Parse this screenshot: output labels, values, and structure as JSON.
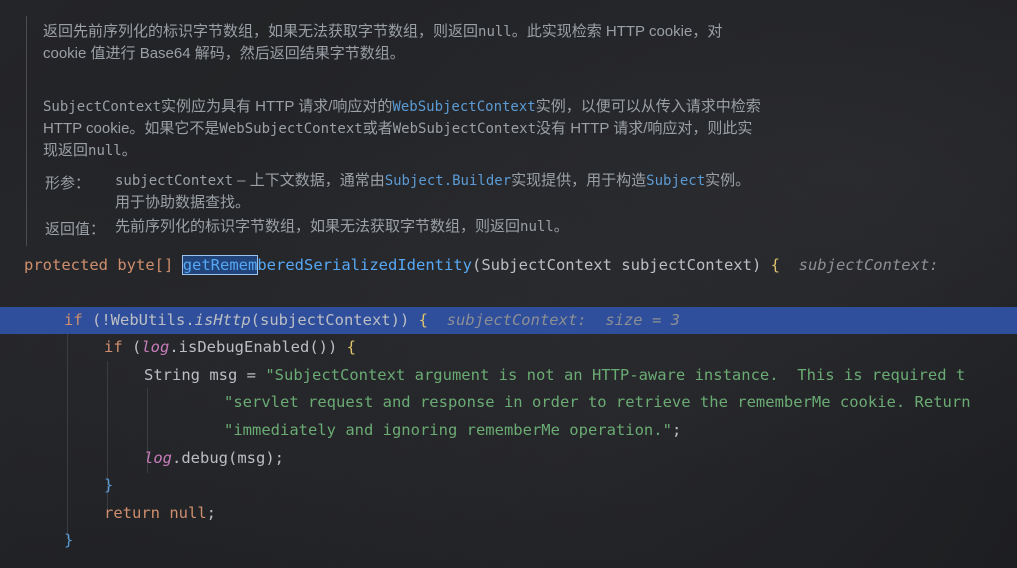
{
  "doc": {
    "para1_line1_a": "返回先前序列化的标识字节数组，如果无法获取字节数组，则返回",
    "para1_null": "null",
    "para1_line1_b": "。此实现检索 HTTP cookie，对",
    "para1_line2": "cookie 值进行 Base64 解码，然后返回结果字节数组。",
    "para2_code1": "SubjectContext",
    "para2_t1": "实例应为具有 HTTP 请求/响应对的",
    "para2_link1": "WebSubjectContext",
    "para2_t2": "实例，以便可以从传入请求中检索",
    "para2_t3": "HTTP cookie。如果它不是",
    "para2_link2": "WebSubjectContext",
    "para2_t4": "或者",
    "para2_link3": "WebSubjectContext",
    "para2_t5": "没有 HTTP 请求/响应对，则此实",
    "para2_t6": "现返回",
    "para2_null": "null",
    "para2_t7": "。",
    "params_label": "形参：",
    "param_name": "subjectContext",
    "param_t1": " – 上下文数据，通常由",
    "param_link1": "Subject.Builder",
    "param_t2": "实现提供，用于构造",
    "param_link2": "Subject",
    "param_t3": "实例。",
    "param_line2": "用于协助数据查找。",
    "returns_label": "返回值：",
    "returns_t1": "先前序列化的标识字节数组，如果无法获取字节数组，则返回",
    "returns_null": "null",
    "returns_t2": "。"
  },
  "code": {
    "l1_protected": "protected",
    "l1_type": "byte[]",
    "l1_method_sel": "getRemem",
    "l1_method_rest": "beredSerializedIdentity",
    "l1_params": "(SubjectContext subjectContext) ",
    "l1_brace": "{",
    "l1_hint": "subjectContext:",
    "l2_if": "if",
    "l2_a": " (!WebUtils.",
    "l2_method": "isHttp",
    "l2_b": "(subjectContext)) ",
    "l2_brace": "{",
    "l2_hint": "subjectContext:  size = 3",
    "l3_if": "if",
    "l3_a": " (",
    "l3_field": "log",
    "l3_b": ".isDebugEnabled()) ",
    "l3_brace": "{",
    "l4_a": "String msg = ",
    "l4_str": "\"SubjectContext argument is not an HTTP-aware instance.  This is required t",
    "l5_str": "\"servlet request and response in order to retrieve the rememberMe cookie. Return",
    "l6_str": "\"immediately and ignoring rememberMe operation.\"",
    "l6_end": ";",
    "l7_field": "log",
    "l7_a": ".debug(msg);",
    "l8_brace": "}",
    "l9_return": "return",
    "l9_null": " null",
    "l9_end": ";",
    "l10_brace": "}"
  }
}
